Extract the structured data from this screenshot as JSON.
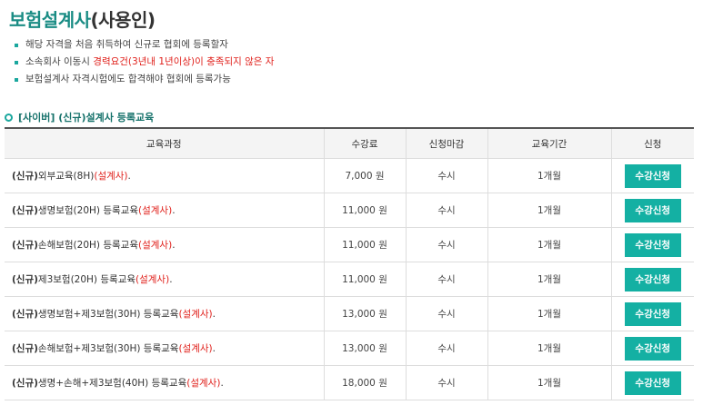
{
  "page": {
    "title_main": "보험설계사",
    "title_sub": "(사용인)",
    "notes": [
      {
        "text": "해당 자격을 처음 취득하여 신규로 협회에 등록할자",
        "red": "",
        "tail": ""
      },
      {
        "text": "소속회사 이동시 ",
        "red": "경력요건(3년내 1년이상)이 충족되지 않은 자",
        "tail": ""
      },
      {
        "text": "보험설계사 자격시험에도 합격해야 협회에 등록가능",
        "red": "",
        "tail": ""
      }
    ],
    "section_title": "[사이버] (신규)설계사 등록교육"
  },
  "table": {
    "headers": [
      "교육과정",
      "수강료",
      "신청마감",
      "교육기간",
      "신청"
    ],
    "rows": [
      {
        "bold": "(신규)",
        "name": "외부교육(8H)",
        "red": "(설계사)",
        "dot": ".",
        "fee": "7,000 원",
        "deadline": "수시",
        "period": "1개월",
        "button": "수강신청"
      },
      {
        "bold": "(신규)",
        "name": "생명보험(20H) 등록교육",
        "red": "(설계사)",
        "dot": ".",
        "fee": "11,000 원",
        "deadline": "수시",
        "period": "1개월",
        "button": "수강신청"
      },
      {
        "bold": "(신규)",
        "name": "손해보험(20H) 등록교육",
        "red": "(설계사)",
        "dot": ".",
        "fee": "11,000 원",
        "deadline": "수시",
        "period": "1개월",
        "button": "수강신청"
      },
      {
        "bold": "(신규)",
        "name": "제3보험(20H) 등록교육",
        "red": "(설계사)",
        "dot": ".",
        "fee": "11,000 원",
        "deadline": "수시",
        "period": "1개월",
        "button": "수강신청"
      },
      {
        "bold": "(신규)",
        "name": "생명보험+제3보험(30H) 등록교육",
        "red": "(설계사)",
        "dot": ".",
        "fee": "13,000 원",
        "deadline": "수시",
        "period": "1개월",
        "button": "수강신청"
      },
      {
        "bold": "(신규)",
        "name": "손해보험+제3보험(30H) 등록교육",
        "red": "(설계사)",
        "dot": ".",
        "fee": "13,000 원",
        "deadline": "수시",
        "period": "1개월",
        "button": "수강신청"
      },
      {
        "bold": "(신규)",
        "name": "생명+손해+제3보험(40H) 등록교육",
        "red": "(설계사)",
        "dot": ".",
        "fee": "18,000 원",
        "deadline": "수시",
        "period": "1개월",
        "button": "수강신청"
      }
    ]
  },
  "colors": {
    "accent": "#14b0a3",
    "title_teal": "#1a8c84",
    "highlight_red": "#e0201b"
  }
}
